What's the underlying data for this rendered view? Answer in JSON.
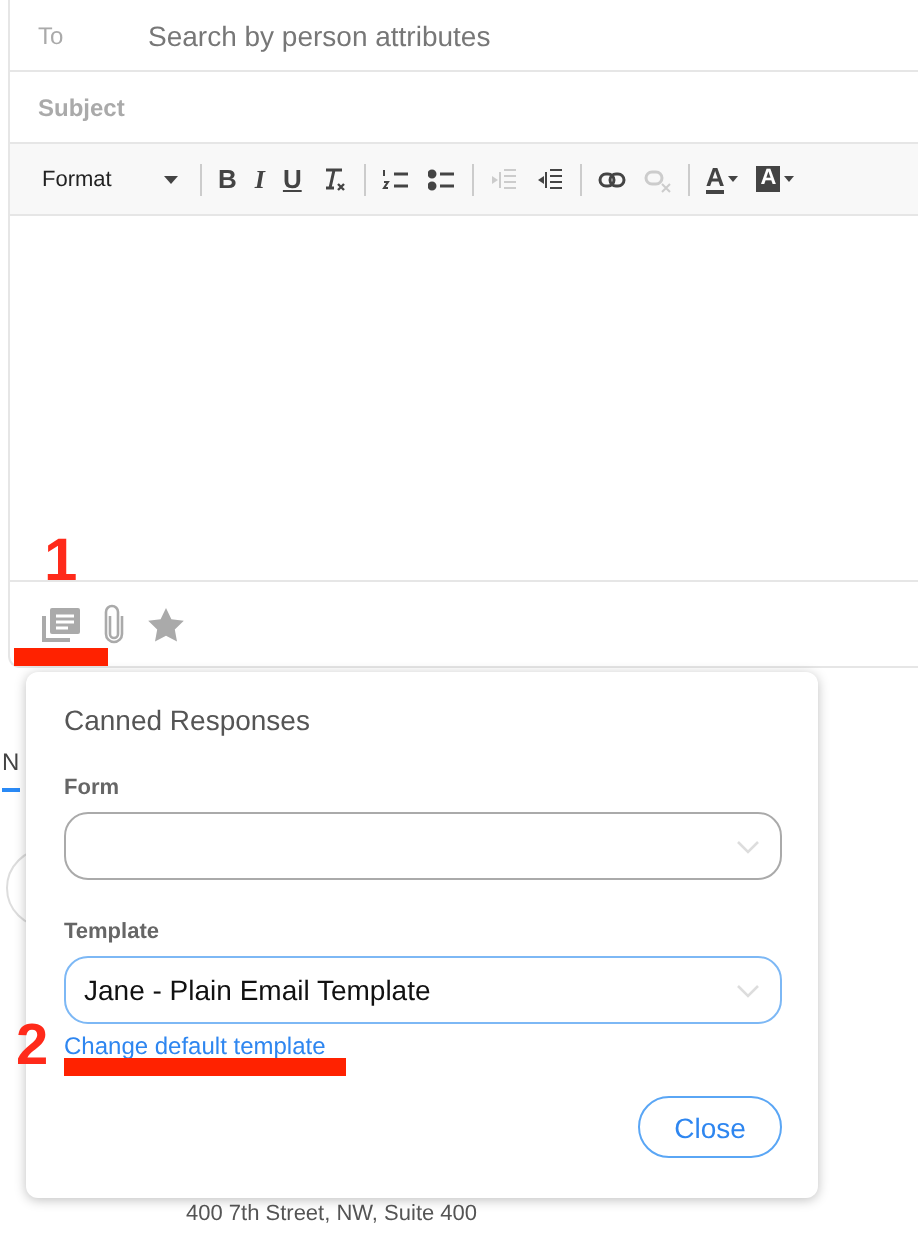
{
  "compose": {
    "to_label": "To",
    "to_placeholder": "Search by person attributes",
    "subject_label": "Subject",
    "toolbar": [
      {
        "kind": "format",
        "label": "Format",
        "disabled": false
      },
      {
        "kind": "sep"
      },
      {
        "kind": "bold",
        "label": "B",
        "disabled": false
      },
      {
        "kind": "italic",
        "label": "I",
        "disabled": false
      },
      {
        "kind": "underline",
        "label": "U",
        "disabled": false
      },
      {
        "kind": "clear",
        "disabled": false
      },
      {
        "kind": "sep"
      },
      {
        "kind": "numbered",
        "disabled": false
      },
      {
        "kind": "bulleted",
        "disabled": false
      },
      {
        "kind": "sep"
      },
      {
        "kind": "outdent",
        "disabled": true
      },
      {
        "kind": "indent",
        "disabled": false
      },
      {
        "kind": "sep"
      },
      {
        "kind": "link",
        "disabled": false
      },
      {
        "kind": "unlink",
        "disabled": true
      },
      {
        "kind": "sep"
      },
      {
        "kind": "textcolor",
        "label": "A",
        "disabled": false
      },
      {
        "kind": "bgcolor",
        "label": "A",
        "disabled": false
      }
    ]
  },
  "background": {
    "tab": "N",
    "address": "400 7th Street, NW, Suite 400"
  },
  "popup": {
    "title": "Canned Responses",
    "form_label": "Form",
    "template_label": "Template",
    "template_value": "Jane - Plain Email Template",
    "link": "Change default template",
    "close": "Close"
  },
  "annotations": [
    {
      "label": "1"
    },
    {
      "label": "2"
    }
  ]
}
